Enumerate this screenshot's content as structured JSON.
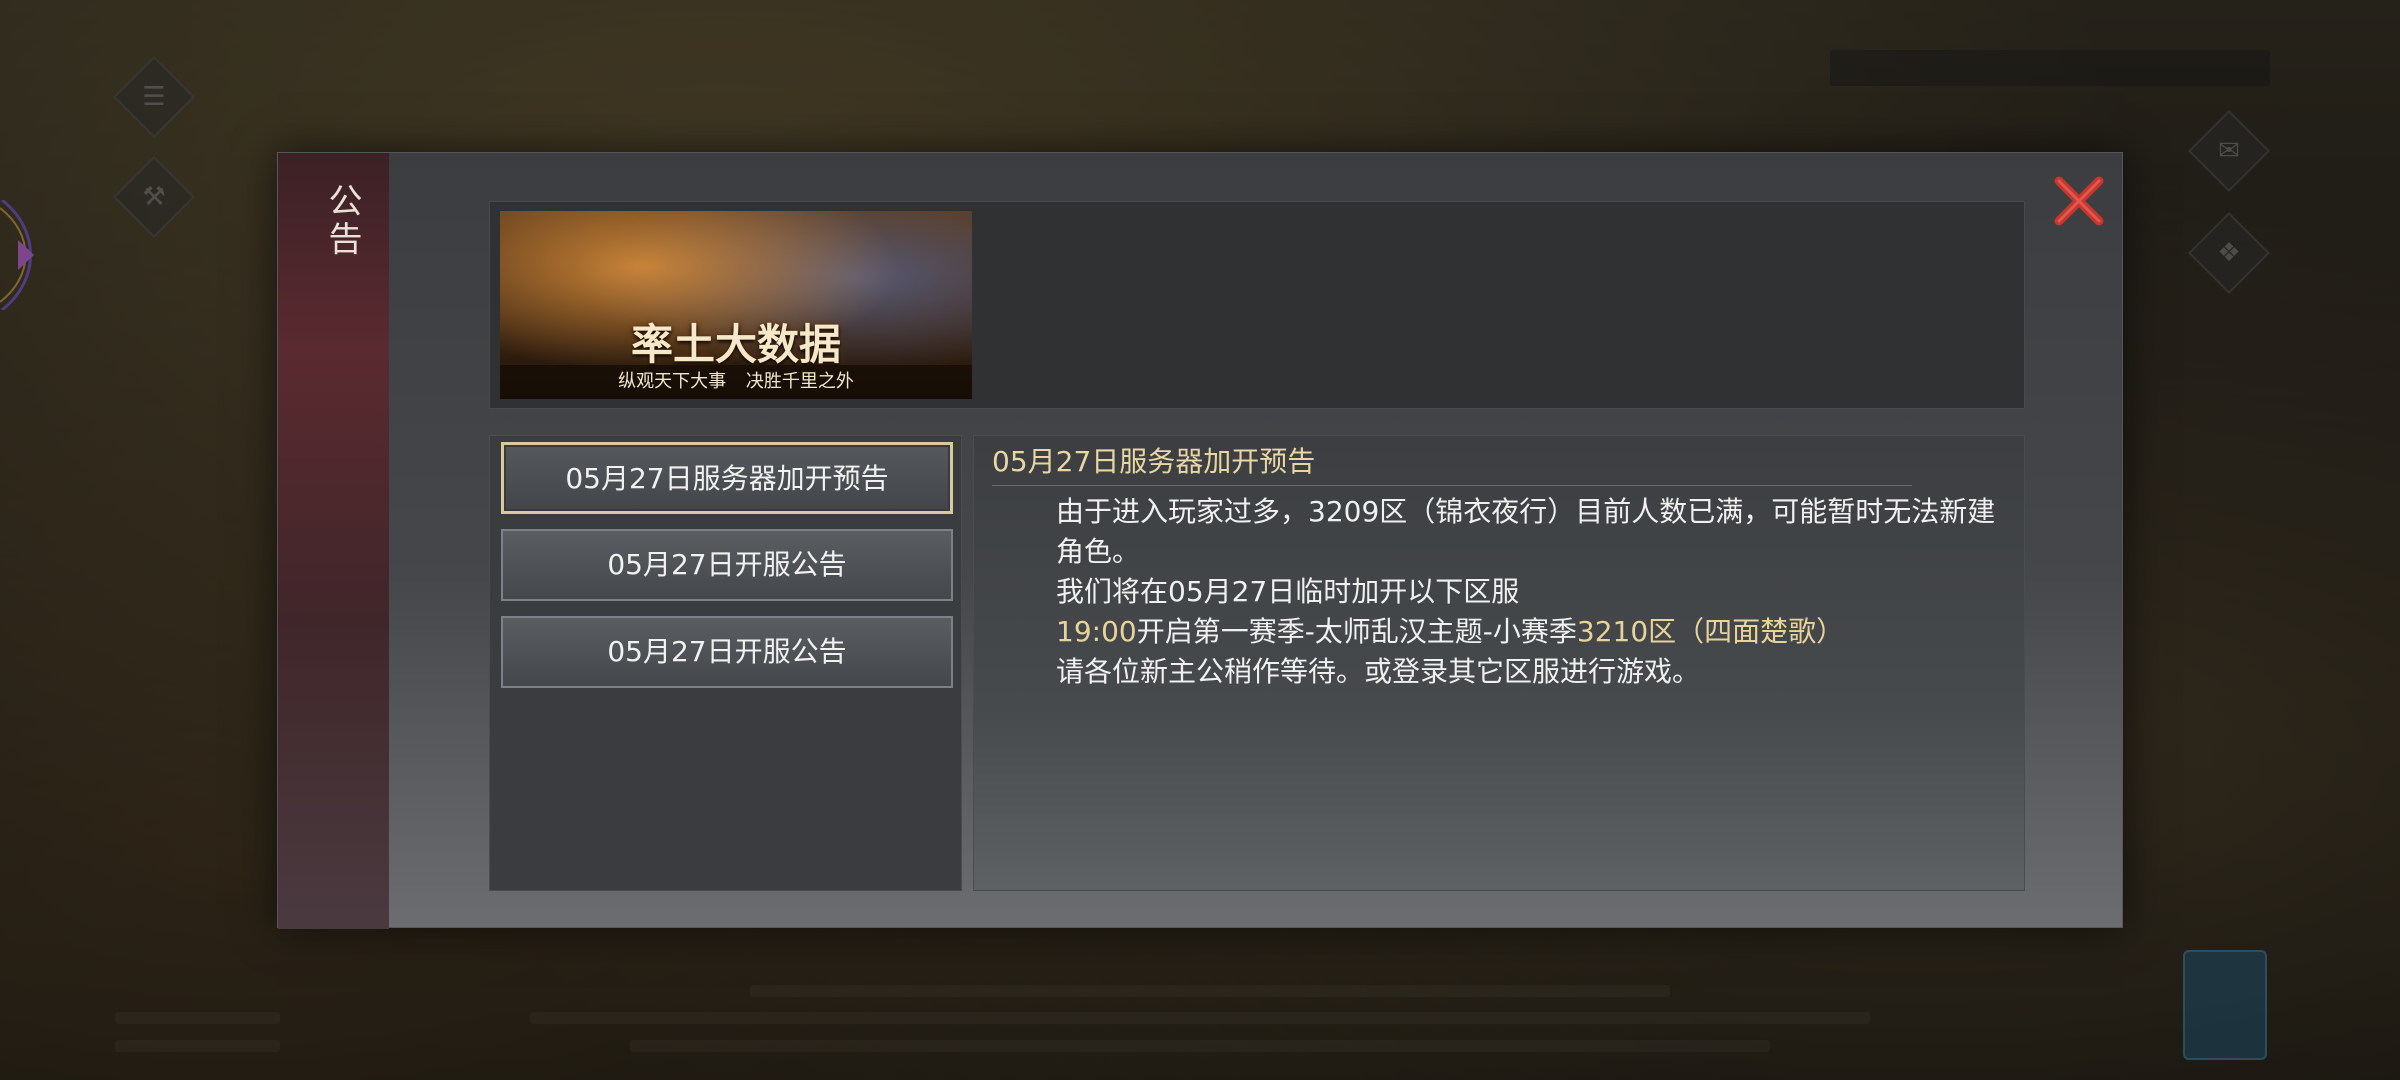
{
  "dialog": {
    "side_title": "公告",
    "banner": {
      "title": "率土大数据",
      "subtitle": "纵观天下大事 决胜千里之外"
    },
    "list": [
      {
        "label": "05月27日服务器加开预告",
        "active": true
      },
      {
        "label": "05月27日开服公告",
        "active": false
      },
      {
        "label": "05月27日开服公告",
        "active": false
      }
    ],
    "content": {
      "title": "05月27日服务器加开预告",
      "para1": "由于进入玩家过多，3209区（锦衣夜行）目前人数已满，可能暂时无法新建角色。",
      "para2": "我们将在05月27日临时加开以下区服",
      "time": "19:00",
      "mid": "开启第一赛季-太师乱汉主题-小赛季",
      "server": "3210区（四面楚歌）",
      "para4": "请各位新主公稍作等待。或登录其它区服进行游戏。"
    }
  },
  "icons": {
    "close": "close-x-icon",
    "colors": {
      "close": "#c8362e",
      "highlight": "#e8d39a",
      "title": "#e8d6a4"
    }
  }
}
